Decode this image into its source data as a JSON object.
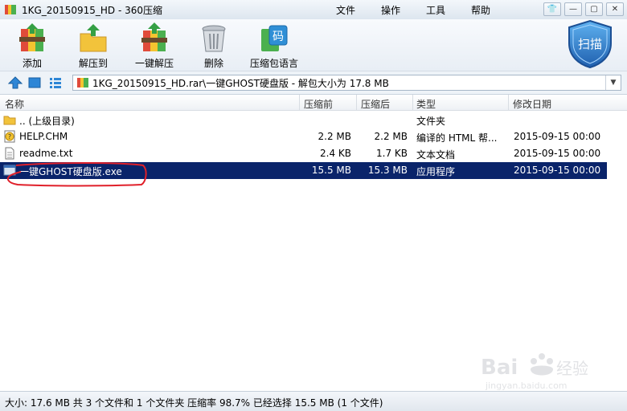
{
  "window": {
    "title": "1KG_20150915_HD - 360压缩",
    "menu": [
      "文件",
      "操作",
      "工具",
      "帮助"
    ]
  },
  "toolbar": {
    "buttons": [
      {
        "label": "添加",
        "icon": "add-archive-icon"
      },
      {
        "label": "解压到",
        "icon": "extract-to-icon"
      },
      {
        "label": "一键解压",
        "icon": "one-click-extract-icon"
      },
      {
        "label": "删除",
        "icon": "delete-trash-icon"
      },
      {
        "label": "压缩包语言",
        "icon": "archive-language-icon"
      }
    ],
    "language_badge": "码",
    "scan_label": "扫描"
  },
  "address": {
    "path": "1KG_20150915_HD.rar\\一键GHOST硬盘版 - 解包大小为 17.8 MB"
  },
  "columns": [
    "名称",
    "压缩前",
    "压缩后",
    "类型",
    "修改日期"
  ],
  "files": [
    {
      "name": ".. (上级目录)",
      "before": "",
      "after": "",
      "type": "文件夹",
      "date": "",
      "icon": "folder-icon"
    },
    {
      "name": "HELP.CHM",
      "before": "2.2 MB",
      "after": "2.2 MB",
      "type": "编译的 HTML 帮...",
      "date": "2015-09-15 00:00",
      "icon": "chm-help-icon"
    },
    {
      "name": "readme.txt",
      "before": "2.4 KB",
      "after": "1.7 KB",
      "type": "文本文档",
      "date": "2015-09-15 00:00",
      "icon": "text-file-icon"
    },
    {
      "name": "一键GHOST硬盘版.exe",
      "before": "15.5 MB",
      "after": "15.3 MB",
      "type": "应用程序",
      "date": "2015-09-15 00:00",
      "icon": "exe-file-icon",
      "selected": true
    }
  ],
  "status": "大小: 17.6 MB 共 3 个文件和 1 个文件夹 压缩率 98.7% 已经选择 15.5 MB (1 个文件)",
  "watermark": {
    "brand": "Bai",
    "brand2": "经验",
    "url": "jingyan.baidu.com"
  },
  "colors": {
    "selection": "#0a246a",
    "annotation": "#e0202a",
    "scan_shield": "#2f7fd0"
  }
}
